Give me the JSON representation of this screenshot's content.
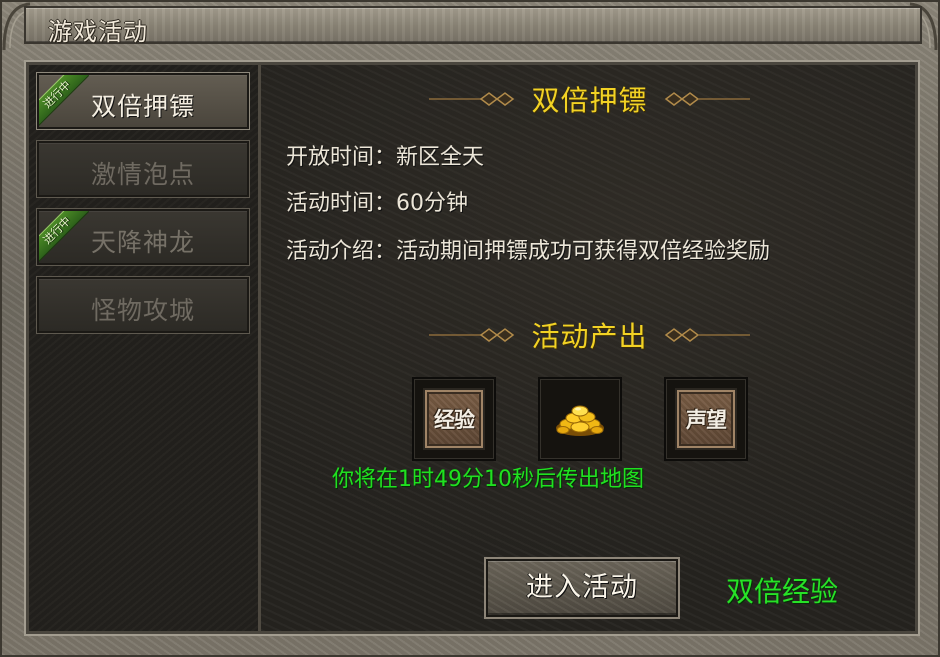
{
  "window": {
    "title": "游戏活动"
  },
  "sidebar": {
    "tabs": [
      {
        "label": "双倍押镖",
        "badge": "进行中",
        "state": "active"
      },
      {
        "label": "激情泡点",
        "badge": "",
        "state": "inactive"
      },
      {
        "label": "天降神龙",
        "badge": "进行中",
        "state": "inactive"
      },
      {
        "label": "怪物攻城",
        "badge": "",
        "state": "inactive"
      }
    ]
  },
  "main": {
    "heading": "双倍押镖",
    "info": [
      {
        "label": "开放时间：",
        "value": "新区全天"
      },
      {
        "label": "活动时间：",
        "value": "60分钟"
      },
      {
        "label": "活动介绍：",
        "value": "活动期间押镖成功可获得双倍经验奖励"
      }
    ],
    "rewards_heading": "活动产出",
    "rewards": [
      {
        "label": "经验",
        "icon": "exp-stone-icon"
      },
      {
        "label": "",
        "icon": "gold-coins-icon"
      },
      {
        "label": "声望",
        "icon": "prestige-stone-icon"
      }
    ],
    "countdown": "你将在1时49分10秒后传出地图",
    "enter_button": "进入活动",
    "bonus_text": "双倍经验"
  },
  "colors": {
    "heading": "#f2d224",
    "highlight_green": "#27e227",
    "badge_green": "#3f7a22",
    "body_text": "#ece6d8"
  }
}
